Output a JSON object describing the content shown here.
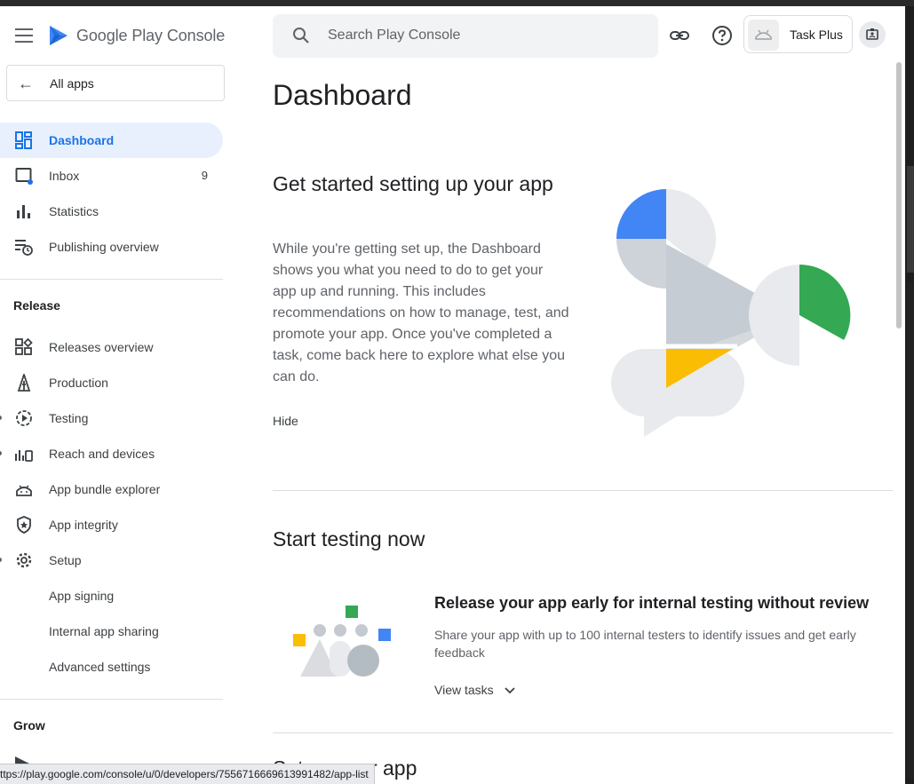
{
  "brand": {
    "name": "Google Play Console"
  },
  "nav": {
    "all_apps": "All apps",
    "primary": [
      {
        "label": "Dashboard",
        "icon": "dashboard-icon"
      },
      {
        "label": "Inbox",
        "icon": "inbox-icon",
        "count": "9"
      },
      {
        "label": "Statistics",
        "icon": "bar-chart-icon"
      },
      {
        "label": "Publishing overview",
        "icon": "publishing-overview-icon"
      }
    ],
    "release_heading": "Release",
    "release": [
      {
        "label": "Releases overview",
        "icon": "releases-icon"
      },
      {
        "label": "Production",
        "icon": "production-icon"
      },
      {
        "label": "Testing",
        "icon": "testing-icon"
      },
      {
        "label": "Reach and devices",
        "icon": "reach-devices-icon"
      },
      {
        "label": "App bundle explorer",
        "icon": "android-icon"
      },
      {
        "label": "App integrity",
        "icon": "shield-icon"
      },
      {
        "label": "Setup",
        "icon": "gear-icon"
      }
    ],
    "setup_sub": [
      {
        "label": "App signing"
      },
      {
        "label": "Internal app sharing"
      },
      {
        "label": "Advanced settings"
      }
    ],
    "grow_heading": "Grow"
  },
  "topbar": {
    "search_placeholder": "Search Play Console",
    "account_name": "Task Plus"
  },
  "main": {
    "title": "Dashboard",
    "setup_card": {
      "heading": "Get started setting up your app",
      "body": "While you're getting set up, the Dashboard shows you what you need to do to get your app up and running. This includes recommendations on how to manage, test, and promote your app. Once you've completed a task, come back here to explore what else you can do.",
      "hide": "Hide"
    },
    "testing": {
      "heading": "Start testing now",
      "task_title": "Release your app early for internal testing without review",
      "task_desc": "Share your app with up to 100 internal testers to identify issues and get early feedback",
      "view_tasks": "View tasks"
    },
    "next_heading_partial": "Set up your app"
  },
  "status_url": "ttps://play.google.com/console/u/0/developers/7556716669613991482/app-list",
  "colors": {
    "accent": "#1a73e8",
    "active_bg": "#e8f0fe",
    "green": "#34a853",
    "yellow": "#fbbc04",
    "blue": "#4285f4"
  }
}
